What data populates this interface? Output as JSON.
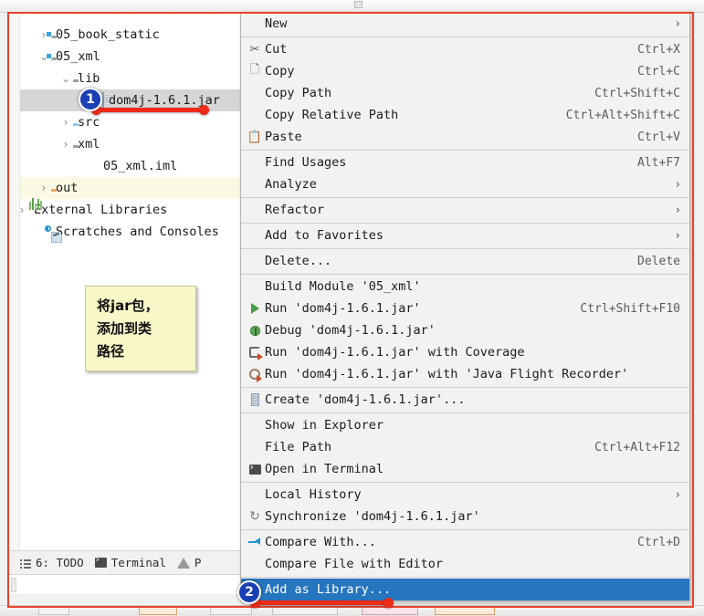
{
  "window": {
    "frame_accent": "#e8432c",
    "menu_highlight": "#2675bf"
  },
  "project_tree": {
    "items": [
      {
        "label": "05_book_static",
        "arrow": "›",
        "icon": "module-folder-icon",
        "indent": 30,
        "state": "collapsed"
      },
      {
        "label": "05_xml",
        "arrow": "⌄",
        "icon": "module-folder-icon",
        "indent": 30,
        "state": "expanded"
      },
      {
        "label": "lib",
        "arrow": "⌄",
        "icon": "folder-icon",
        "indent": 54,
        "state": "expanded"
      },
      {
        "label": "dom4j-1.6.1.jar",
        "arrow": "",
        "icon": "jar-icon",
        "indent": 78,
        "state": "selected"
      },
      {
        "label": "src",
        "arrow": "›",
        "icon": "source-folder-icon",
        "indent": 54,
        "state": "collapsed"
      },
      {
        "label": "xml",
        "arrow": "›",
        "icon": "folder-icon",
        "indent": 54,
        "state": "collapsed"
      },
      {
        "label": "05_xml.iml",
        "arrow": "",
        "icon": "iml-file-icon",
        "indent": 78,
        "state": "none"
      },
      {
        "label": "out",
        "arrow": "›",
        "icon": "excluded-folder-icon",
        "indent": 30,
        "state": "highlighted"
      },
      {
        "label": "External Libraries",
        "arrow": "›",
        "icon": "external-libraries-icon",
        "indent": 6,
        "state": "collapsed"
      },
      {
        "label": "Scratches and Consoles",
        "arrow": "",
        "icon": "scratches-icon",
        "indent": 30,
        "state": "none"
      }
    ]
  },
  "note": {
    "line1": "将jar包，",
    "line2": "添加到类",
    "line3": "路径"
  },
  "status_bar": {
    "todo": "6: TODO",
    "todo_index": "6",
    "terminal": "Terminal",
    "problems": "P"
  },
  "context_menu": {
    "items": [
      {
        "label": "New",
        "shortcut": "",
        "submenu": "›",
        "icon": "",
        "sep_after": true,
        "selected": false
      },
      {
        "label": "Cut",
        "shortcut": "Ctrl+X",
        "submenu": "",
        "icon": "cut-icon",
        "sep_after": false,
        "selected": false
      },
      {
        "label": "Copy",
        "shortcut": "Ctrl+C",
        "submenu": "",
        "icon": "copy-icon",
        "sep_after": false,
        "selected": false
      },
      {
        "label": "Copy Path",
        "shortcut": "Ctrl+Shift+C",
        "submenu": "",
        "icon": "",
        "sep_after": false,
        "selected": false
      },
      {
        "label": "Copy Relative Path",
        "shortcut": "Ctrl+Alt+Shift+C",
        "submenu": "",
        "icon": "",
        "sep_after": false,
        "selected": false
      },
      {
        "label": "Paste",
        "shortcut": "Ctrl+V",
        "submenu": "",
        "icon": "paste-icon",
        "sep_after": true,
        "selected": false
      },
      {
        "label": "Find Usages",
        "shortcut": "Alt+F7",
        "submenu": "",
        "icon": "",
        "sep_after": false,
        "selected": false
      },
      {
        "label": "Analyze",
        "shortcut": "",
        "submenu": "›",
        "icon": "",
        "sep_after": true,
        "selected": false
      },
      {
        "label": "Refactor",
        "shortcut": "",
        "submenu": "›",
        "icon": "",
        "sep_after": true,
        "selected": false
      },
      {
        "label": "Add to Favorites",
        "shortcut": "",
        "submenu": "›",
        "icon": "",
        "sep_after": true,
        "selected": false
      },
      {
        "label": "Delete...",
        "shortcut": "Delete",
        "submenu": "",
        "icon": "",
        "sep_after": true,
        "selected": false
      },
      {
        "label": "Build Module '05_xml'",
        "shortcut": "",
        "submenu": "",
        "icon": "",
        "sep_after": false,
        "selected": false
      },
      {
        "label": "Run 'dom4j-1.6.1.jar'",
        "shortcut": "Ctrl+Shift+F10",
        "submenu": "",
        "icon": "run-icon",
        "sep_after": false,
        "selected": false
      },
      {
        "label": "Debug 'dom4j-1.6.1.jar'",
        "shortcut": "",
        "submenu": "",
        "icon": "debug-icon",
        "sep_after": false,
        "selected": false
      },
      {
        "label": "Run 'dom4j-1.6.1.jar' with Coverage",
        "shortcut": "",
        "submenu": "",
        "icon": "coverage-icon",
        "sep_after": false,
        "selected": false
      },
      {
        "label": "Run 'dom4j-1.6.1.jar' with 'Java Flight Recorder'",
        "shortcut": "",
        "submenu": "",
        "icon": "flight-recorder-icon",
        "sep_after": true,
        "selected": false
      },
      {
        "label": "Create 'dom4j-1.6.1.jar'...",
        "shortcut": "",
        "submenu": "",
        "icon": "jar-icon",
        "sep_after": true,
        "selected": false
      },
      {
        "label": "Show in Explorer",
        "shortcut": "",
        "submenu": "",
        "icon": "",
        "sep_after": false,
        "selected": false
      },
      {
        "label": "File Path",
        "shortcut": "Ctrl+Alt+F12",
        "submenu": "",
        "icon": "",
        "sep_after": false,
        "selected": false
      },
      {
        "label": "Open in Terminal",
        "shortcut": "",
        "submenu": "",
        "icon": "terminal-icon",
        "sep_after": true,
        "selected": false
      },
      {
        "label": "Local History",
        "shortcut": "",
        "submenu": "›",
        "icon": "",
        "sep_after": false,
        "selected": false
      },
      {
        "label": "Synchronize 'dom4j-1.6.1.jar'",
        "shortcut": "",
        "submenu": "",
        "icon": "sync-icon",
        "sep_after": true,
        "selected": false
      },
      {
        "label": "Compare With...",
        "shortcut": "Ctrl+D",
        "submenu": "",
        "icon": "compare-icon",
        "sep_after": false,
        "selected": false
      },
      {
        "label": "Compare File with Editor",
        "shortcut": "",
        "submenu": "",
        "icon": "",
        "sep_after": true,
        "selected": false
      },
      {
        "label": "Add as Library...",
        "shortcut": "",
        "submenu": "",
        "icon": "",
        "sep_after": false,
        "selected": true
      }
    ]
  },
  "callouts": [
    {
      "number": "1",
      "target": "dom4j-1.6.1.jar tree node"
    },
    {
      "number": "2",
      "target": "Add as Library... menu item"
    }
  ]
}
